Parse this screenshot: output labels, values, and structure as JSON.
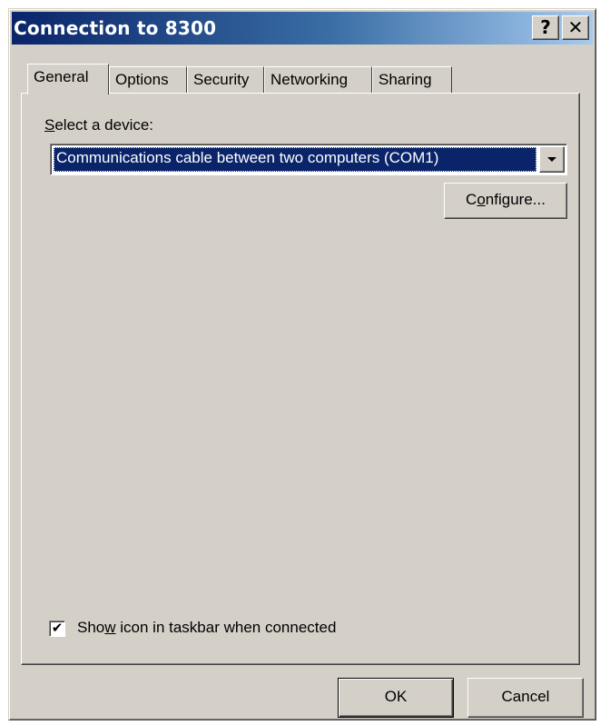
{
  "window": {
    "title": "Connection to 8300",
    "help_glyph": "?",
    "close_glyph": "✕"
  },
  "tabs": [
    {
      "label": "General",
      "active": true
    },
    {
      "label": "Options",
      "active": false
    },
    {
      "label": "Security",
      "active": false
    },
    {
      "label": "Networking",
      "active": false
    },
    {
      "label": "Sharing",
      "active": false
    }
  ],
  "general": {
    "select_label_first": "S",
    "select_label_rest": "elect a device:",
    "device_value": "Communications cable between two computers (COM1)",
    "configure_pre": "C",
    "configure_mnemonic": "o",
    "configure_post": "nfigure...",
    "show_icon_pre": "Sho",
    "show_icon_mnemonic": "w",
    "show_icon_post": " icon in taskbar when connected",
    "show_icon_checked": true
  },
  "buttons": {
    "ok": "OK",
    "cancel": "Cancel"
  },
  "colors": {
    "dialog_face": "#d4d0c8",
    "title_active": "#0a246a",
    "selection": "#0a246a"
  }
}
